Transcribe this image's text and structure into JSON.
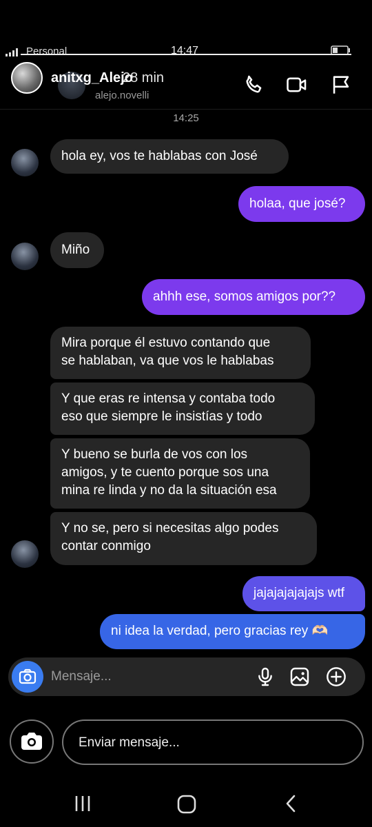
{
  "status_bar": {
    "carrier": "Personal",
    "time": "14:47"
  },
  "header": {
    "name": "anitxg_Alejo",
    "time_ago": "28 min",
    "handle": "alejo.novelli",
    "icons": [
      "phone-icon",
      "video-icon",
      "flag-icon"
    ]
  },
  "timestamp": "14:25",
  "messages": [
    {
      "from": "them",
      "text": "hola ey, vos te hablabas con José"
    },
    {
      "from": "me",
      "text": "holaa, que josé?"
    },
    {
      "from": "them",
      "text": "Miño"
    },
    {
      "from": "me",
      "text": "ahhh ese, somos amigos por??"
    },
    {
      "from": "them",
      "text_lines": [
        "Mira porque él estuvo contando que",
        "se hablaban, va que vos le hablabas"
      ]
    },
    {
      "from": "them",
      "text_lines": [
        "Y que eras re intensa y contaba todo",
        "eso que siempre le insistías y todo"
      ]
    },
    {
      "from": "them",
      "text_lines": [
        "Y bueno se burla de vos con los",
        "amigos, y te cuento porque sos una",
        "mina re linda y no da la situación esa"
      ]
    },
    {
      "from": "them",
      "text_lines": [
        "Y no se, pero si necesitas algo podes",
        "contar conmigo"
      ]
    },
    {
      "from": "me",
      "text": "jajajajajajajs wtf"
    },
    {
      "from": "me",
      "text": "ni idea la verdad, pero gracias rey 🫶🏻"
    }
  ],
  "composer": {
    "placeholder": "Mensaje...",
    "icons": [
      "camera-icon",
      "mic-icon",
      "gallery-icon",
      "add-icon"
    ]
  },
  "reply_bar": {
    "placeholder": "Enviar mensaje..."
  },
  "nav": {
    "icons": [
      "recents-icon",
      "home-icon",
      "back-icon"
    ]
  },
  "colors": {
    "sent_purple": "#7c3aed",
    "sent_blue": "#3766e6",
    "received": "#262626",
    "camera_button": "#3a7cf0"
  }
}
